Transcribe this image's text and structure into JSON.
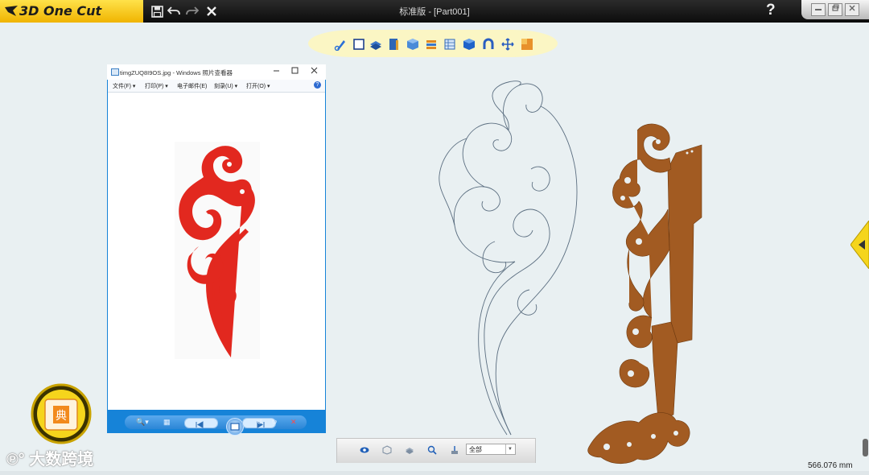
{
  "app": {
    "logo_text": "3D One Cut",
    "window_title": "标准版 - [Part001]",
    "help_label": "?",
    "brand_color": "#f5c518"
  },
  "quick_toolbar": {
    "icons": [
      "save-icon",
      "undo-icon",
      "redo-icon",
      "close-icon"
    ]
  },
  "tool_ribbon": {
    "tools": [
      "pen-icon",
      "square-icon",
      "layers-icon",
      "book-icon",
      "box-icon",
      "stack-icon",
      "grid-icon",
      "cube-icon",
      "magnet-icon",
      "move-icon",
      "material-icon"
    ]
  },
  "photo_viewer": {
    "title": "timgZUQ8I9OS.jpg - Windows 照片查看器",
    "menu": [
      "文件(F)",
      "打印(P)",
      "电子邮件(E)",
      "刻录(U)",
      "打开(O)"
    ],
    "image_color": "#e2281f"
  },
  "bottom_toolbar": {
    "icons": [
      "eye-icon",
      "cube-outline-icon",
      "layers-icon",
      "zoom-icon",
      "filter-icon"
    ],
    "filter_value": "全部"
  },
  "status": {
    "measurement": "566.076 mm"
  },
  "model_color": "#a25b22",
  "watermark": {
    "text": "大数跨境"
  }
}
